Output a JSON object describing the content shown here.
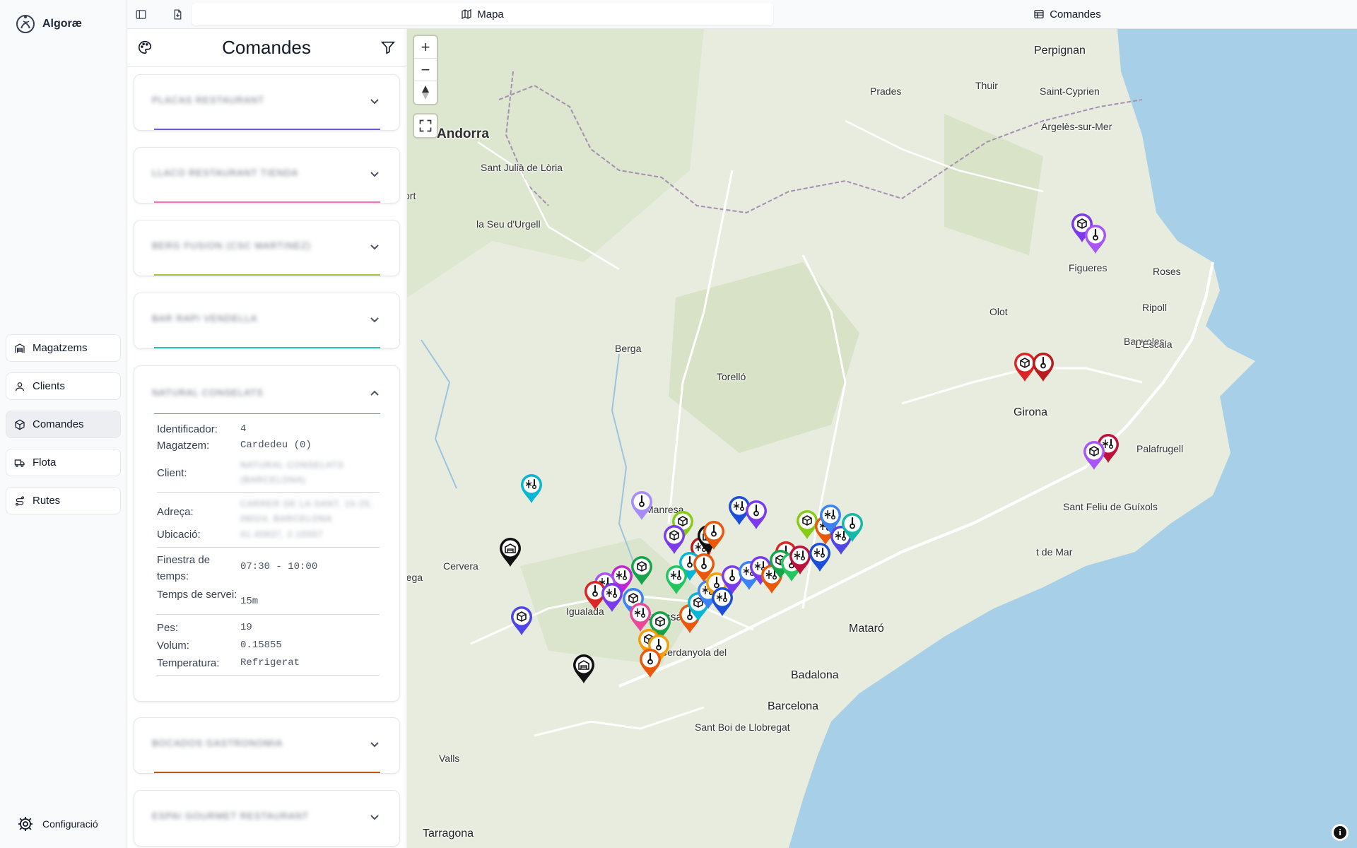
{
  "app": {
    "name": "Algoræ"
  },
  "nav": {
    "items": [
      {
        "label": "Magatzems",
        "icon": "warehouse-icon",
        "active": false
      },
      {
        "label": "Clients",
        "icon": "user-icon",
        "active": false
      },
      {
        "label": "Comandes",
        "icon": "package-icon",
        "active": true
      },
      {
        "label": "Flota",
        "icon": "truck-icon",
        "active": false
      },
      {
        "label": "Rutes",
        "icon": "route-icon",
        "active": false
      }
    ],
    "config_label": "Configuració"
  },
  "tabs": {
    "map": "Mapa",
    "orders": "Comandes"
  },
  "panel": {
    "title": "Comandes",
    "orders": [
      {
        "name": "PLACAS RESTAURANT",
        "color": "#6d5bd0",
        "expanded": false
      },
      {
        "name": "LLACO RESTAURANT TIENDA",
        "color": "#f472b6",
        "expanded": false
      },
      {
        "name": "BERG FUSION (CSC MARTINEZ)",
        "color": "#a3c93a",
        "expanded": false
      },
      {
        "name": "BAR RAPI VENDELLA",
        "color": "#2dbfb8",
        "expanded": false
      },
      {
        "name": "NATURAL CONSELATS",
        "color": "#5b8fa8",
        "expanded": true,
        "details": {
          "id_label": "Identificador:",
          "id": "4",
          "warehouse_label": "Magatzem:",
          "warehouse": "Cardedeu (0)",
          "client_label": "Client:",
          "client": "NATURAL CONSELATS (BARCELONA)",
          "address_label": "Adreça:",
          "address": "CARRER DE LA SANT, 15-25, 08024, BARCELONA",
          "location_label": "Ubicació:",
          "location": "41.40837, 2.15557",
          "window_label": "Finestra de temps:",
          "window": "07:30 - 10:00",
          "service_label": "Temps de servei:",
          "service": "15m",
          "weight_label": "Pes:",
          "weight": "19",
          "volume_label": "Volum:",
          "volume": "0.15855",
          "temperature_label": "Temperatura:",
          "temperature": "Refrigerat"
        }
      },
      {
        "name": "BOCADOS GASTRONOMIA",
        "color": "#c2570c",
        "expanded": false
      },
      {
        "name": "ESPAI GOURMET RESTAURANT",
        "color": "#6b7280",
        "expanded": false
      }
    ]
  },
  "map": {
    "labels": [
      {
        "text": "Perpignan",
        "size": "mid"
      },
      {
        "text": "Prades",
        "size": ""
      },
      {
        "text": "Thuir",
        "size": ""
      },
      {
        "text": "Saint-Cyprien",
        "size": ""
      },
      {
        "text": "Argelès-sur-Mer",
        "size": ""
      },
      {
        "text": "Andorra",
        "size": "big"
      },
      {
        "text": "Sant Julià de Lòria",
        "size": ""
      },
      {
        "text": "ort",
        "size": ""
      },
      {
        "text": "la Seu d'Urgell",
        "size": ""
      },
      {
        "text": "Figueres",
        "size": ""
      },
      {
        "text": "Roses",
        "size": ""
      },
      {
        "text": "Ripoll",
        "size": ""
      },
      {
        "text": "Olot",
        "size": ""
      },
      {
        "text": "Banyoles",
        "size": ""
      },
      {
        "text": "Berga",
        "size": ""
      },
      {
        "text": "L'Escala",
        "size": ""
      },
      {
        "text": "Torelló",
        "size": ""
      },
      {
        "text": "Girona",
        "size": "mid"
      },
      {
        "text": "Palafrugell",
        "size": ""
      },
      {
        "text": "Sant Feliu de Guíxols",
        "size": ""
      },
      {
        "text": "Manresa",
        "size": ""
      },
      {
        "text": "Cervera",
        "size": ""
      },
      {
        "text": "rega",
        "size": ""
      },
      {
        "text": "Igualada",
        "size": ""
      },
      {
        "text": "Terrassa",
        "size": "mid"
      },
      {
        "text": "t de Mar",
        "size": ""
      },
      {
        "text": "Cerdanyola del",
        "size": ""
      },
      {
        "text": "Badalona",
        "size": "mid"
      },
      {
        "text": "Barcelona",
        "size": "mid"
      },
      {
        "text": "Sant Boi de Llobregat",
        "size": ""
      },
      {
        "text": "Valls",
        "size": ""
      },
      {
        "text": "Tarragona",
        "size": "mid"
      },
      {
        "text": "Mataró",
        "size": "mid"
      }
    ],
    "zoom_in": "+",
    "zoom_out": "−",
    "info": "i"
  }
}
